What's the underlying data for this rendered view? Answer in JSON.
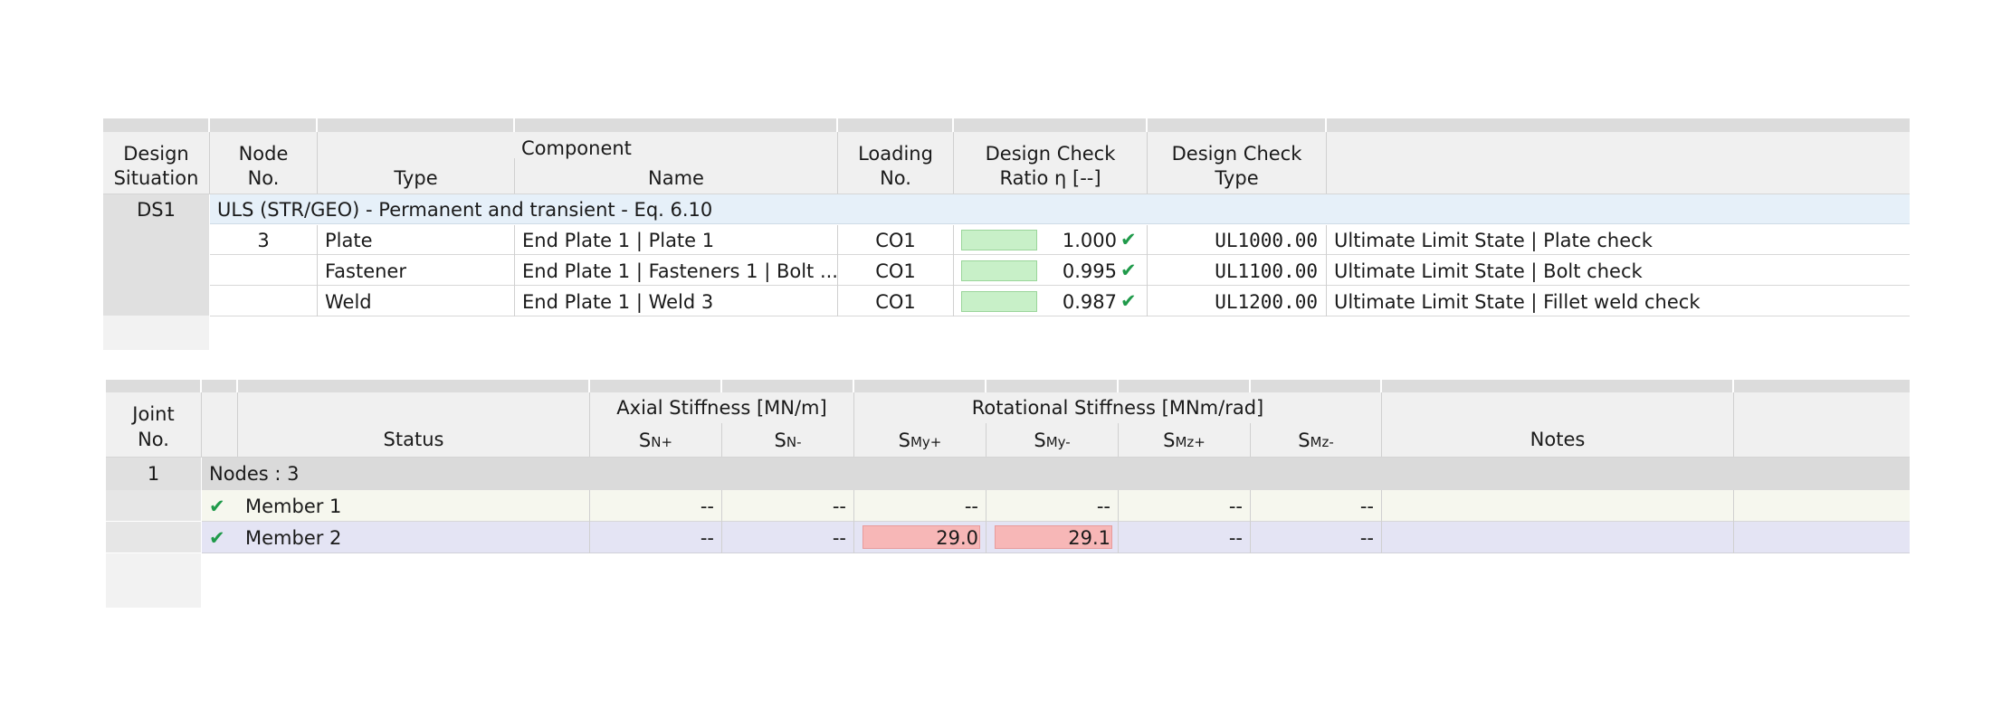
{
  "table1": {
    "headers": {
      "design_situation_1": "Design",
      "design_situation_2": "Situation",
      "node_1": "Node",
      "node_2": "No.",
      "component": "Component",
      "type": "Type",
      "name": "Name",
      "loading_1": "Loading",
      "loading_2": "No.",
      "ratio_1": "Design Check",
      "ratio_2": "Ratio η [--]",
      "dctype_1": "Design Check",
      "dctype_2": "Type"
    },
    "group": {
      "ds": "DS1",
      "label": "ULS (STR/GEO) - Permanent and transient - Eq. 6.10"
    },
    "rows": [
      {
        "node": "3",
        "type": "Plate",
        "name": "End Plate 1 | Plate 1",
        "loading": "CO1",
        "ratio": "1.000",
        "ratio_value": 1.0,
        "check_code": "UL1000.00",
        "check_desc": "Ultimate Limit State | Plate check"
      },
      {
        "node": "",
        "type": "Fastener",
        "name": "End Plate 1 | Fasteners 1 | Bolt ...",
        "loading": "CO1",
        "ratio": "0.995",
        "ratio_value": 0.995,
        "check_code": "UL1100.00",
        "check_desc": "Ultimate Limit State | Bolt check"
      },
      {
        "node": "",
        "type": "Weld",
        "name": "End Plate 1 | Weld 3",
        "loading": "CO1",
        "ratio": "0.987",
        "ratio_value": 0.987,
        "check_code": "UL1200.00",
        "check_desc": "Ultimate Limit State | Fillet weld check"
      }
    ]
  },
  "table2": {
    "headers": {
      "joint_1": "Joint",
      "joint_2": "No.",
      "status": "Status",
      "axial": "Axial Stiffness [MN/m]",
      "rotational": "Rotational Stiffness [MNm/rad]",
      "sn_plus": "S",
      "sn_plus_sub": "N+",
      "sn_minus": "S",
      "sn_minus_sub": "N-",
      "smy_plus": "S",
      "smy_plus_sub": "My+",
      "smy_minus": "S",
      "smy_minus_sub": "My-",
      "smz_plus": "S",
      "smz_plus_sub": "Mz+",
      "smz_minus": "S",
      "smz_minus_sub": "Mz-",
      "notes": "Notes"
    },
    "group": {
      "joint": "1",
      "label": "Nodes : 3"
    },
    "rows": [
      {
        "status": "Member 1",
        "sn_plus": "--",
        "sn_minus": "--",
        "smy_plus": "--",
        "smy_minus": "--",
        "smz_plus": "--",
        "smz_minus": "--"
      },
      {
        "status": "Member 2",
        "sn_plus": "--",
        "sn_minus": "--",
        "smy_plus": "29.0",
        "smy_minus": "29.1",
        "smz_plus": "--",
        "smz_minus": "--"
      }
    ]
  },
  "colors": {
    "group_row_bg": "#e6f0f9",
    "ratio_bar": "#c8f0c8",
    "check_mark": "#1f9a4a",
    "highlight_red": "#f7b7b7",
    "member2_row_bg": "#e4e4f4",
    "member1_row_bg": "#f6f7ee"
  }
}
